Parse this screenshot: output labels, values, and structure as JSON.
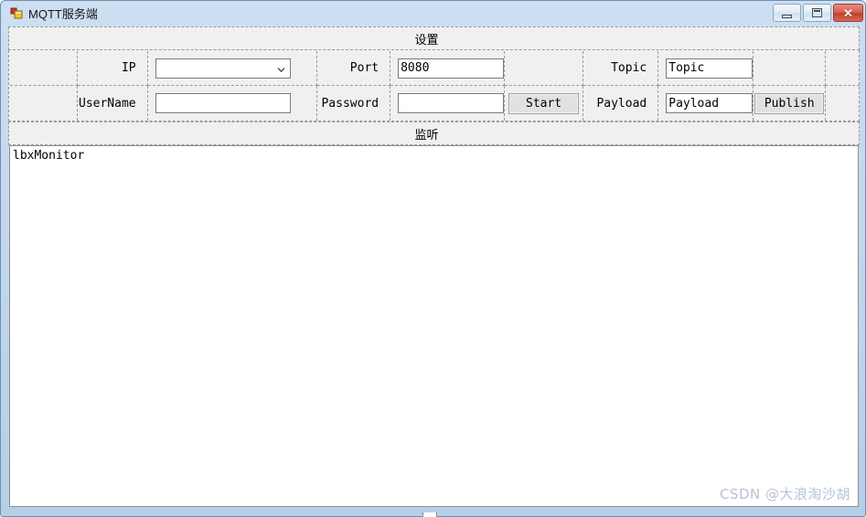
{
  "window": {
    "title": "MQTT服务端",
    "icon": "form-designer-icon",
    "controls": {
      "minimize_label": "minimize-icon",
      "maximize_label": "maximize-icon",
      "close_label": "✕"
    }
  },
  "sections": {
    "settings_header": "设置",
    "monitor_header": "监听"
  },
  "form": {
    "ip": {
      "label": "IP",
      "value": "",
      "placeholder": ""
    },
    "port": {
      "label": "Port",
      "value": "8080",
      "placeholder": ""
    },
    "username": {
      "label": "UserName",
      "value": "",
      "placeholder": ""
    },
    "password": {
      "label": "Password",
      "value": "",
      "placeholder": ""
    },
    "topic": {
      "label": "Topic",
      "value": "Topic",
      "placeholder": "Topic"
    },
    "payload": {
      "label": "Payload",
      "value": "Payload",
      "placeholder": "Payload"
    },
    "start_button": "Start",
    "publish_button": "Publish"
  },
  "monitor": {
    "items": [
      "lbxMonitor"
    ]
  },
  "watermark": "CSDN @大浪淘沙胡",
  "colors": {
    "window_frame": "#6f8fb0",
    "titlebar_gradient_top": "#cddff0",
    "titlebar_gradient_bottom": "#b5cfe8",
    "panel_bg": "#f0f0f0",
    "dashed_border": "#9a9a9a",
    "textbox_bg": "#ffffff",
    "button_bg": "#e1e1e1",
    "close_button": "#bf3f2d",
    "watermark_text": "#b6c3d2"
  }
}
